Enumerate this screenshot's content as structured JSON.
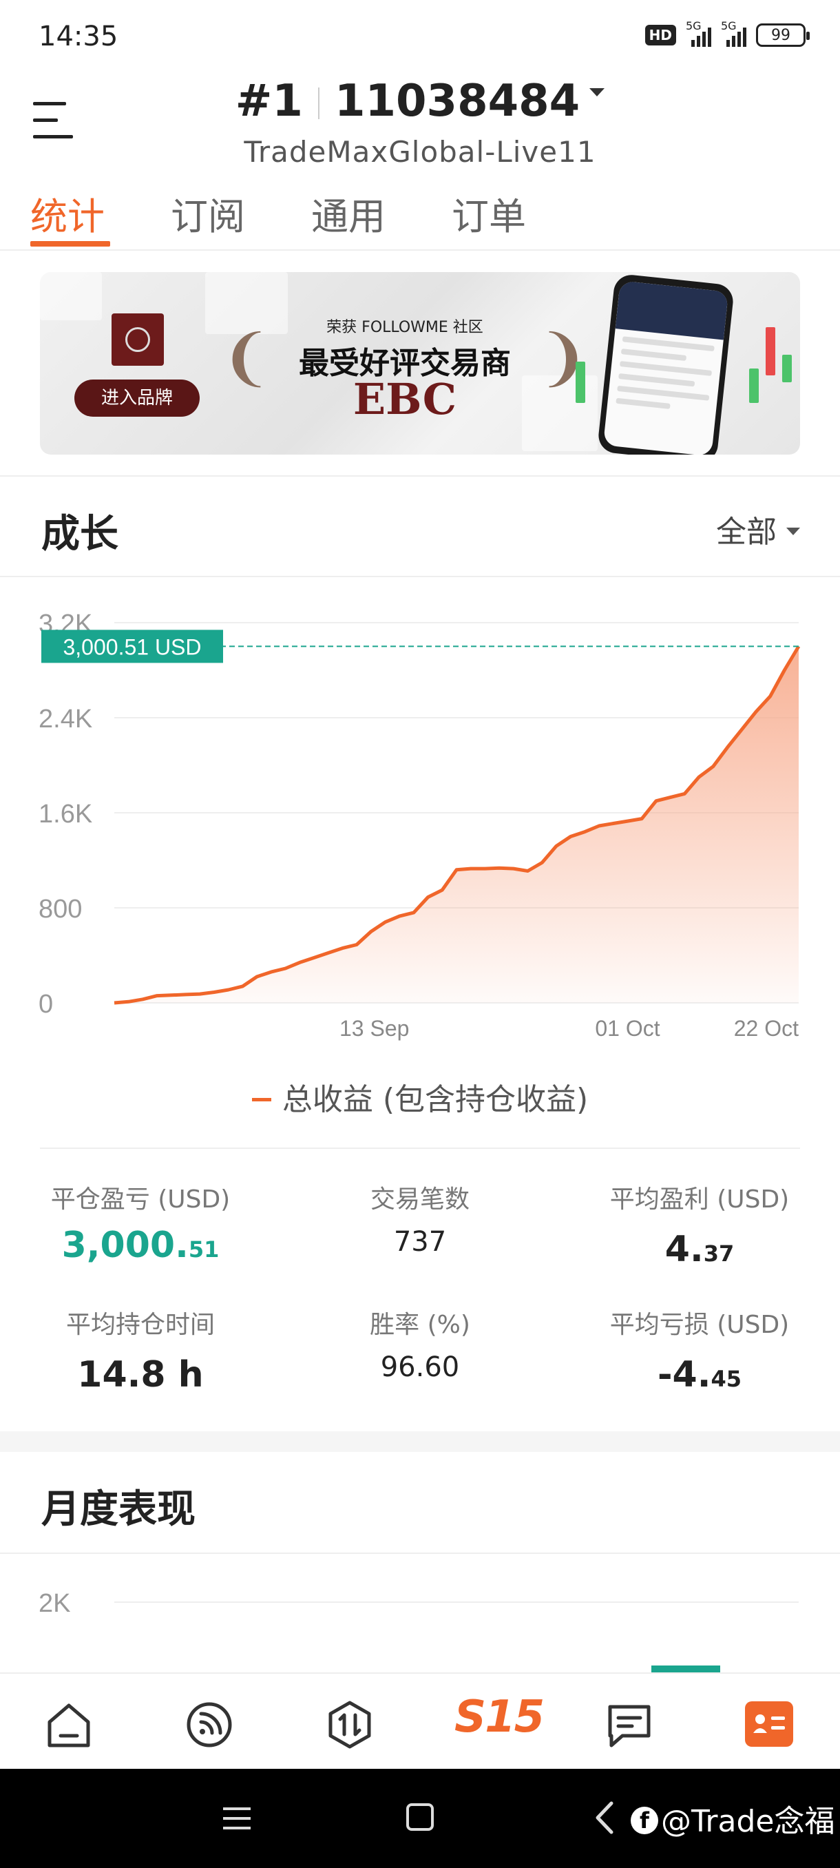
{
  "status_bar": {
    "time": "14:35",
    "hd_label": "HD",
    "network_1": "5G",
    "network_2": "5G",
    "battery": "99"
  },
  "header": {
    "rank": "#1",
    "account_id": "11038484",
    "server": "TradeMaxGlobal-Live11"
  },
  "tabs": [
    {
      "label": "统计",
      "active": true
    },
    {
      "label": "订阅",
      "active": false
    },
    {
      "label": "通用",
      "active": false
    },
    {
      "label": "订单",
      "active": false
    }
  ],
  "banner": {
    "enter_brand": "进入品牌",
    "small_text": "荣获 FOLLOWME 社区",
    "main_text": "最受好评交易商",
    "brand": "EBC"
  },
  "growth": {
    "title": "成长",
    "period": "全部",
    "legend": "总收益 (包含持仓收益)"
  },
  "chart_data": [
    {
      "type": "area",
      "title": "",
      "xlabel": "",
      "ylabel": "",
      "y_tick_labels": [
        "0",
        "800",
        "1.6K",
        "2.4K",
        "3.2K"
      ],
      "y_ticks": [
        0,
        800,
        1600,
        2400,
        3200
      ],
      "x_tick_labels": [
        "13 Sep",
        "01 Oct",
        "22 Oct"
      ],
      "ylim": [
        0,
        3200
      ],
      "current_value_label": "3,000.51 USD",
      "current_value": 3000.51,
      "series": [
        {
          "name": "总收益 (包含持仓收益)",
          "values": [
            0,
            10,
            30,
            60,
            65,
            70,
            75,
            90,
            110,
            140,
            220,
            260,
            290,
            340,
            380,
            420,
            460,
            490,
            600,
            680,
            730,
            760,
            890,
            950,
            1120,
            1130,
            1130,
            1135,
            1130,
            1110,
            1180,
            1320,
            1400,
            1440,
            1490,
            1510,
            1530,
            1550,
            1700,
            1730,
            1760,
            1900,
            1990,
            2150,
            2300,
            2450,
            2580,
            2800,
            3000.51
          ]
        }
      ],
      "colors": {
        "line": "#f0662a",
        "fill": "#f7a98a",
        "marker": "#1aa58e"
      }
    },
    {
      "type": "bar",
      "title": "",
      "y_tick_labels": [
        "2K"
      ],
      "visible_partial": true
    }
  ],
  "stats": [
    {
      "label": "平仓盈亏 (USD)",
      "int": "3,000.",
      "frac": "51",
      "style": "green"
    },
    {
      "label": "交易笔数",
      "int": "737",
      "frac": "",
      "style": "plain"
    },
    {
      "label": "平均盈利 (USD)",
      "int": "4.",
      "frac": "37",
      "style": "normal"
    },
    {
      "label": "平均持仓时间",
      "int": "14.8 h",
      "frac": "",
      "style": "normal"
    },
    {
      "label": "胜率 (%)",
      "int": "96.60",
      "frac": "",
      "style": "plain"
    },
    {
      "label": "平均亏损 (USD)",
      "int": "-4.",
      "frac": "45",
      "style": "normal"
    }
  ],
  "monthly": {
    "title": "月度表现"
  },
  "bottom_nav": {
    "items": [
      "home-icon",
      "feed-icon",
      "trade-icon",
      "s15-icon",
      "messages-icon",
      "profile-icon"
    ],
    "s15_label": "S15"
  },
  "watermark": "@Trade念福"
}
